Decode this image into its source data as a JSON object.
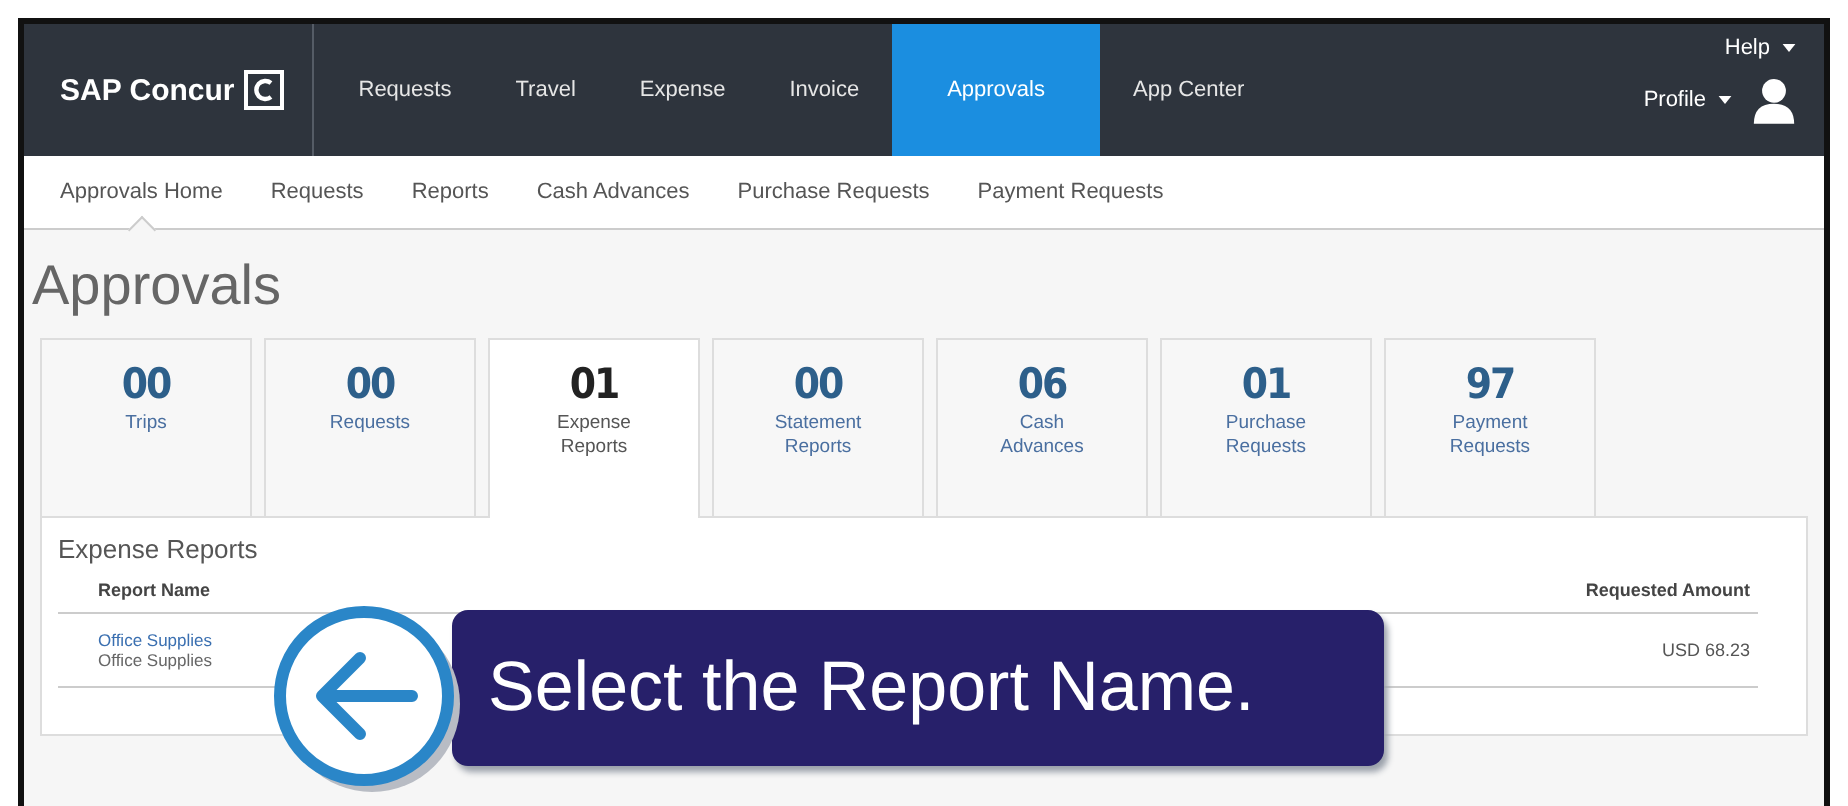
{
  "header": {
    "logo": "SAP Concur",
    "menu": [
      {
        "label": "Requests",
        "selected": false
      },
      {
        "label": "Travel",
        "selected": false
      },
      {
        "label": "Expense",
        "selected": false
      },
      {
        "label": "Invoice",
        "selected": false
      },
      {
        "label": "Approvals",
        "selected": true
      },
      {
        "label": "App Center",
        "selected": false
      }
    ],
    "help": "Help",
    "profile": "Profile"
  },
  "subnav": [
    {
      "label": "Approvals Home",
      "selected": true
    },
    {
      "label": "Requests",
      "selected": false
    },
    {
      "label": "Reports",
      "selected": false
    },
    {
      "label": "Cash Advances",
      "selected": false
    },
    {
      "label": "Purchase Requests",
      "selected": false
    },
    {
      "label": "Payment Requests",
      "selected": false
    }
  ],
  "page_title": "Approvals",
  "tiles": [
    {
      "count": "00",
      "label": "Trips",
      "selected": false
    },
    {
      "count": "00",
      "label": "Requests",
      "selected": false
    },
    {
      "count": "01",
      "label": "Expense Reports",
      "selected": true
    },
    {
      "count": "00",
      "label": "Statement Reports",
      "selected": false
    },
    {
      "count": "06",
      "label": "Cash Advances",
      "selected": false
    },
    {
      "count": "01",
      "label": "Purchase Requests",
      "selected": false
    },
    {
      "count": "97",
      "label": "Payment Requests",
      "selected": false
    }
  ],
  "panel": {
    "title": "Expense Reports",
    "columns": [
      "Report Name",
      "Requested Amount"
    ],
    "rows": [
      {
        "name": "Office Supplies",
        "detail": "Office Supplies",
        "amount": "USD 68.23"
      }
    ]
  },
  "callout": {
    "text": "Select the Report Name."
  }
}
